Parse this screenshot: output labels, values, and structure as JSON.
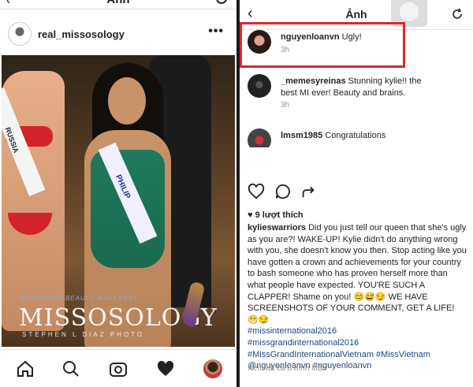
{
  "left": {
    "topbar_title": "Ảnh",
    "username": "real_missosology",
    "more_label": "•••",
    "photo": {
      "sash_left_text": "RUSSIA",
      "sash_main_text": "PHILIP",
      "watermark_small": "ANALYZING BEAUTY PAGEANTS",
      "watermark_brand": "MISSOSOLOGY",
      "watermark_photo": "STEPHEN L DIAZ PHOTO"
    }
  },
  "right": {
    "topbar_title": "Ảnh",
    "comments": [
      {
        "user": "nguyenloanvn",
        "text": "Ugly!",
        "time": "3h"
      },
      {
        "user": "_memesyreinas",
        "text": "Stunning kylie!! the best MI ever! Beauty and brains.",
        "time": "3h"
      },
      {
        "user": "lmsm1985",
        "text": "Congratulations",
        "time": ""
      }
    ],
    "likes": "9 lượt thích",
    "caption_user": "kylieswarriors",
    "caption_text": "Did you just tell our queen that she's ugly as you are?! WAKE-UP! Kylie didn't do anything wrong with you, she doesn't know you then. Stop acting like you have gotten a crown and achievements for your country to bash someone who has proven herself more than what people have expected. YOU'RE SUCH A CLAPPER! Shame on you! 😊😅😏 WE HAVE SCREENSHOTS OF YOUR COMMENT, GET A LIFE! 😁😏",
    "hashtags": [
      "#missinternational2016",
      "#missgrandinternational2016",
      "#MissGrandInternationalVietnam #MissVietnam",
      "@nguyenloanvn #nguyenloanvn"
    ],
    "view_all": "Xem tất cả 8 bình luận"
  },
  "colors": {
    "highlight": "#e0262c",
    "hashtag": "#1a4a80",
    "swimsuit": "#1f7a5c"
  },
  "icons": [
    "back-icon",
    "refresh-icon",
    "more-icon",
    "heart-icon",
    "comment-icon",
    "share-icon",
    "home-icon",
    "search-icon",
    "camera-icon",
    "profile-icon"
  ]
}
